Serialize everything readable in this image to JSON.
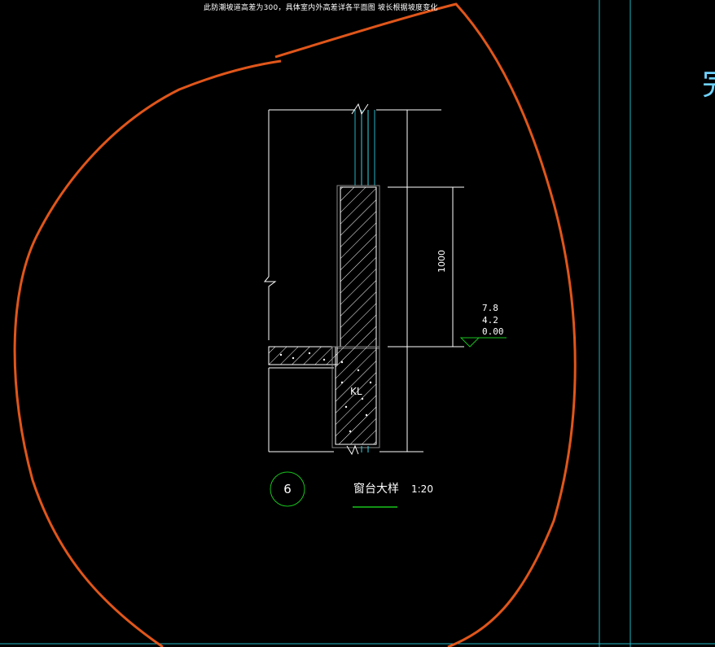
{
  "note_text": "此防潮坡道高差为300，具体室内外高差详各平面图 坡长根据坡度变化",
  "detail": {
    "number": "6",
    "title": "窗台大样",
    "scale": "1:20"
  },
  "dimension": "1000",
  "elevations": [
    "7.8",
    "4.2",
    "0.00"
  ],
  "beam_label": "KL",
  "edge_glyph": "完",
  "colors": {
    "background": "#000000",
    "lines": "#ffffff",
    "glass": "#33d6e6",
    "frame": "#1fb5c2",
    "circle": "#18c21e",
    "markup": "#e0561a",
    "underline": "#18c21e"
  }
}
